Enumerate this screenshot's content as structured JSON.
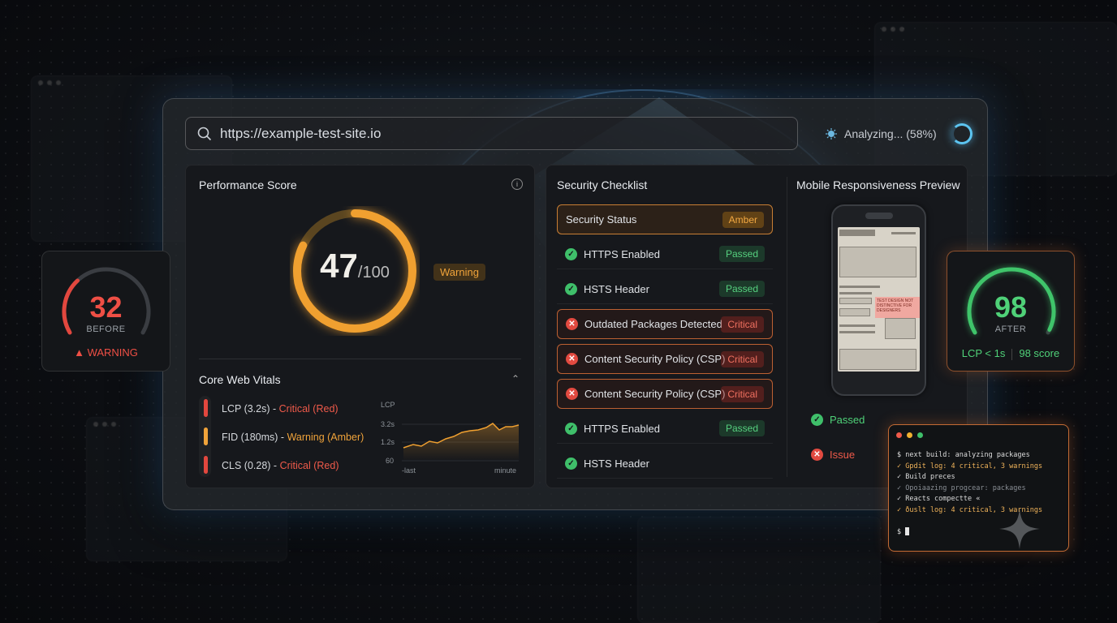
{
  "search": {
    "url": "https://example-test-site.io"
  },
  "status": {
    "analyzing_label": "Analyzing... (58%)",
    "progress": 0.58
  },
  "performance": {
    "title": "Performance Score",
    "score": "47",
    "max": "/100",
    "score_value": 47,
    "badge": "Warning",
    "cwv_title": "Core Web Vitals",
    "vitals": [
      {
        "metric": "LCP (3.2s) - ",
        "severity": "Critical (Red)",
        "level": "red"
      },
      {
        "metric": "FID (180ms) - ",
        "severity": "Warning (Amber)",
        "level": "amber"
      },
      {
        "metric": "CLS (0.28) - ",
        "severity": "Critical (Red)",
        "level": "red"
      }
    ],
    "mini_chart": {
      "label": "LCP",
      "yticks": [
        "3.2s",
        "1.2s",
        "60"
      ],
      "x_start": "-last",
      "x_end": "minute"
    }
  },
  "security": {
    "title": "Security Checklist",
    "items": [
      {
        "label": "Security Status",
        "tag": "Amber",
        "state": "amber"
      },
      {
        "label": "HTTPS Enabled",
        "tag": "Passed",
        "state": "passed"
      },
      {
        "label": "HSTS Header",
        "tag": "Passed",
        "state": "passed"
      },
      {
        "label": "Outdated Packages Detected",
        "tag": "Critical",
        "state": "critical"
      },
      {
        "label": "Content Security Policy (CSP)",
        "tag": "Critical",
        "state": "critical"
      },
      {
        "label": "Content Security Policy (CSP)",
        "tag": "Critical",
        "state": "critical"
      },
      {
        "label": "HTTPS Enabled",
        "tag": "Passed",
        "state": "passed"
      },
      {
        "label": "HSTS Header",
        "tag": "",
        "state": "passed"
      }
    ]
  },
  "mobile": {
    "title": "Mobile Responsiveness Preview",
    "passed_label": "Passed",
    "issue_label": "Issue"
  },
  "before_card": {
    "score": "32",
    "label": "BEFORE",
    "warning": "WARNING",
    "score_value": 32
  },
  "after_card": {
    "score": "98",
    "label": "AFTER",
    "lcp": "LCP < 1s",
    "score_text": "98 score",
    "score_value": 98
  },
  "terminal": {
    "lines": [
      {
        "text": "$ next build: analyzing packages",
        "cls": ""
      },
      {
        "text": "✓ Gpdit log: 4 critical, 3 warnings",
        "cls": "hl"
      },
      {
        "text": "✓ Build preces",
        "cls": ""
      },
      {
        "text": "✓ Opoiaazing progcear: packages",
        "cls": "dim"
      },
      {
        "text": "✓ Reacts compectte «",
        "cls": ""
      },
      {
        "text": "✓ ðuslt log: 4 critical, 3 warnings",
        "cls": "hl"
      }
    ],
    "prompt": "$"
  },
  "colors": {
    "warning": "#f0a33a",
    "critical": "#ef5a4a",
    "passed": "#4fd178",
    "accent": "#5cc4f0"
  }
}
